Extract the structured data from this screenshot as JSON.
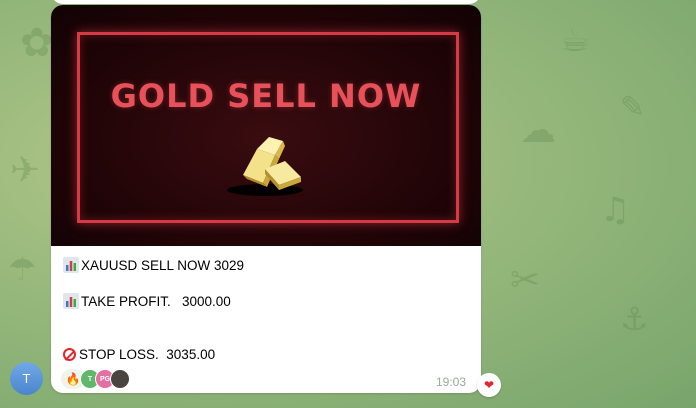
{
  "chat": {
    "sender_avatar_initial": "T",
    "message": {
      "image": {
        "headline": "GOLD SELL NOW",
        "graphic": "gold-bars"
      },
      "lines": [
        {
          "icon": "bar-chart-icon",
          "text": "XAUUSD SELL NOW 3029"
        },
        {
          "icon": "bar-chart-icon",
          "text": "TAKE PROFIT.   3000.00"
        },
        {
          "icon": "no-entry-icon",
          "text": "STOP LOSS.  3035.00"
        }
      ],
      "reactions": {
        "emoji": "🔥",
        "reactor_initials": [
          "T",
          "PG",
          ""
        ]
      },
      "time": "19:03",
      "user_reaction": "❤"
    }
  }
}
